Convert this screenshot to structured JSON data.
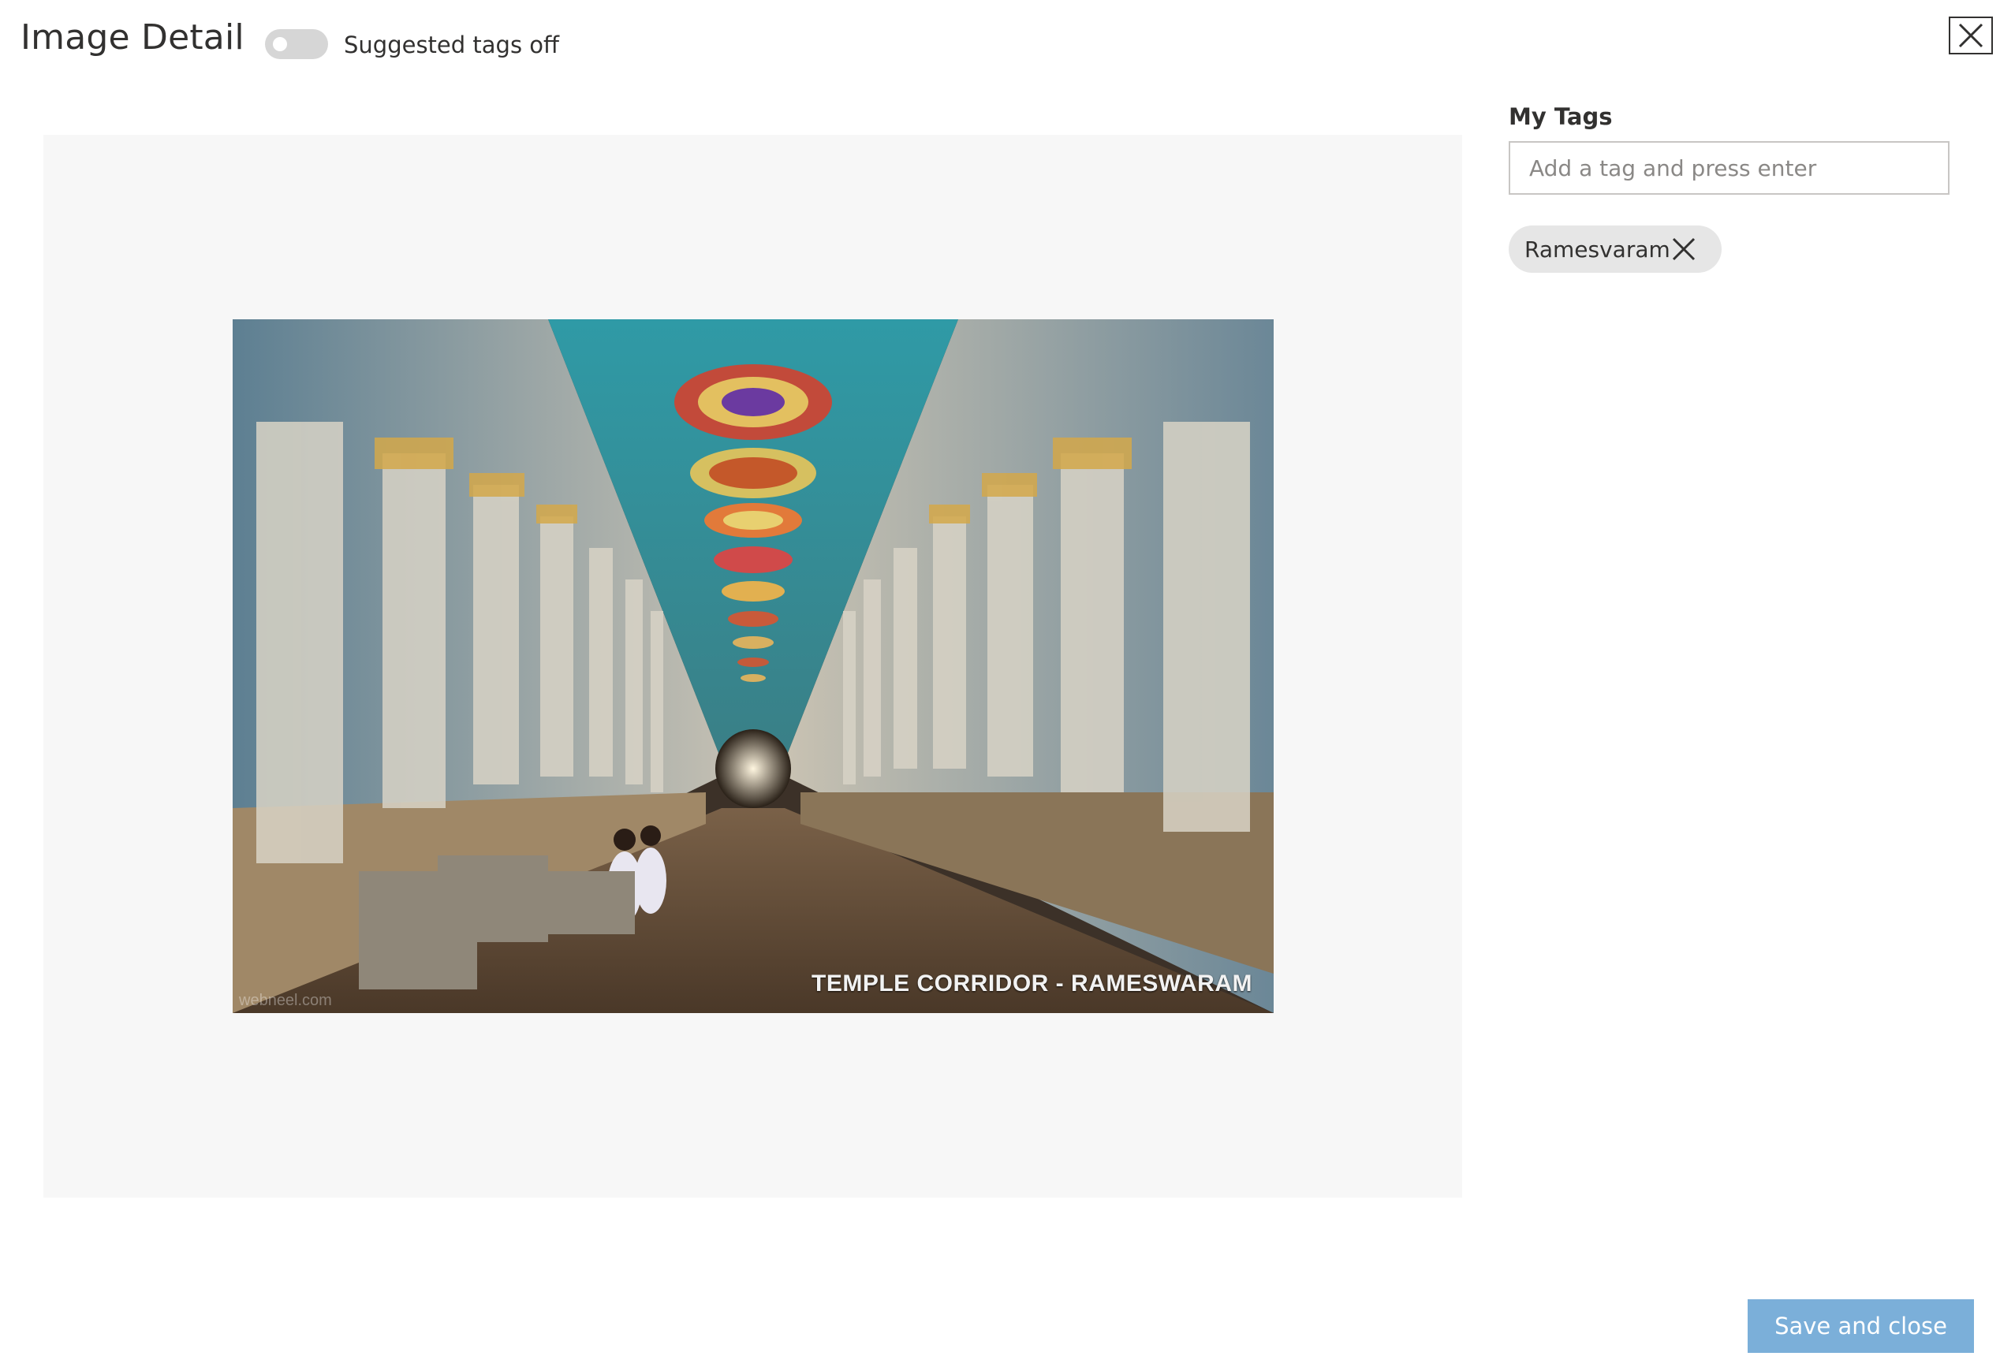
{
  "header": {
    "title": "Image Detail",
    "suggested_toggle": {
      "label": "Suggested tags off",
      "state": "off"
    },
    "close_icon": "close-icon"
  },
  "image": {
    "caption": "TEMPLE CORRIDOR - RAMESWARAM",
    "watermark": "webneel.com"
  },
  "tags": {
    "heading": "My Tags",
    "input_placeholder": "Add a tag and press enter",
    "input_value": "",
    "items": [
      {
        "label": "Ramesvaram",
        "remove_icon": "close-icon"
      }
    ]
  },
  "footer": {
    "save_label": "Save and close"
  },
  "colors": {
    "panel_bg": "#f7f7f7",
    "toggle_off": "#d6d6d6",
    "chip_bg": "#e6e6e6",
    "primary_disabled": "#7bafd9",
    "text": "#323130"
  }
}
